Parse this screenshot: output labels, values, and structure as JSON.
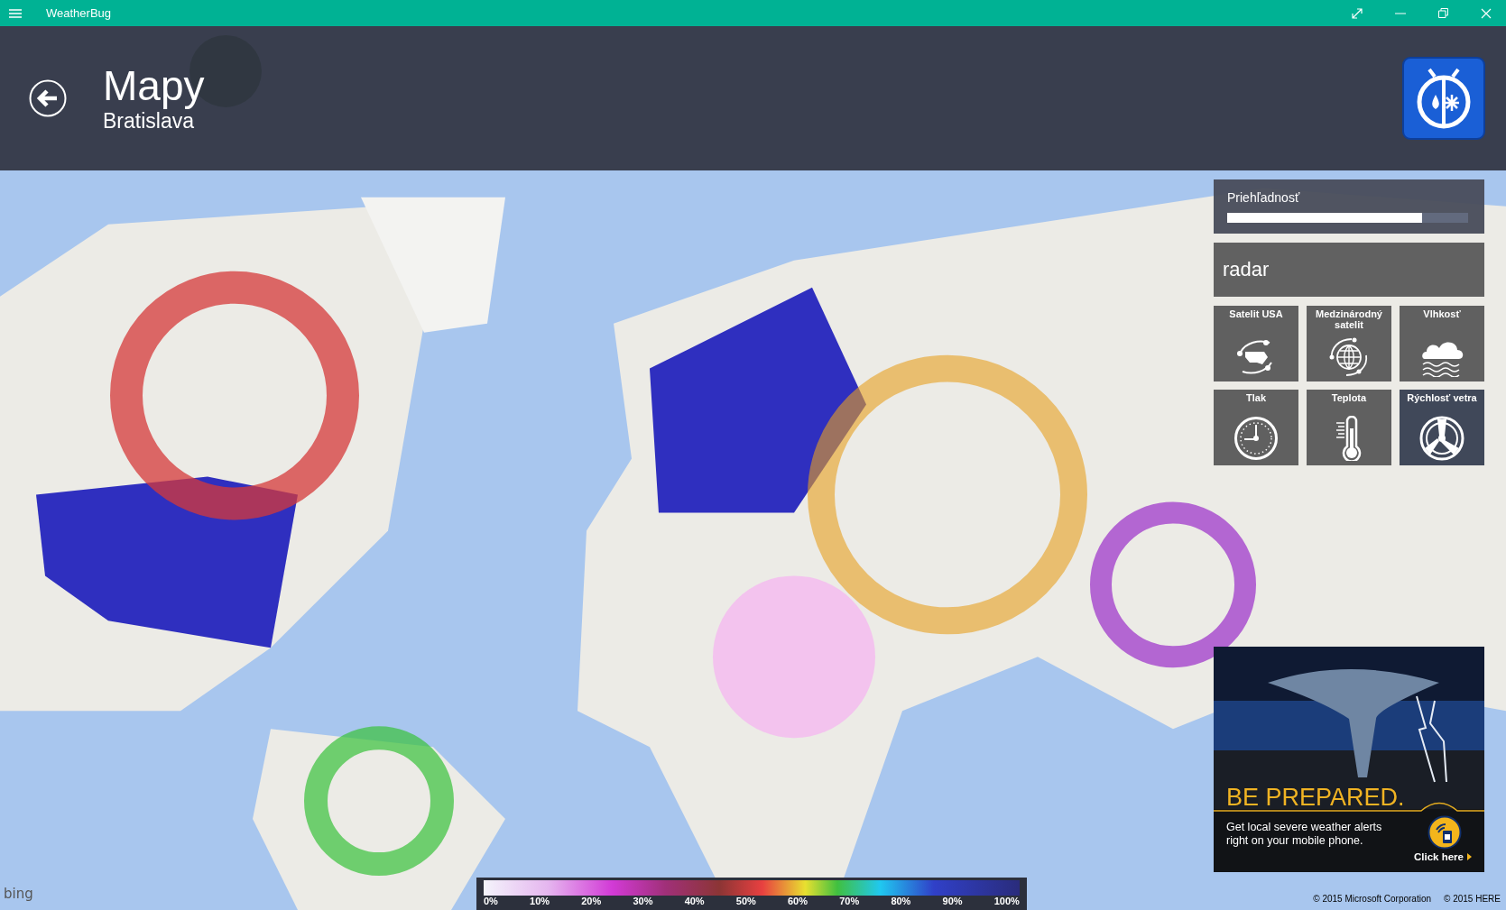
{
  "window": {
    "title": "WeatherBug"
  },
  "header": {
    "title": "Mapy",
    "subtitle": "Bratislava"
  },
  "transparency": {
    "label": "Priehľadnosť",
    "level": 0.81
  },
  "layer_group": {
    "label": "radar"
  },
  "layers": [
    {
      "label": "Satelit USA",
      "kind": "usa_satellite",
      "selected": false
    },
    {
      "label": "Medzinárodný satelit",
      "kind": "world_satellite",
      "selected": false
    },
    {
      "label": "Vlhkosť",
      "kind": "humidity",
      "selected": false
    },
    {
      "label": "Tlak",
      "kind": "pressure",
      "selected": false
    },
    {
      "label": "Teplota",
      "kind": "temperature",
      "selected": false
    },
    {
      "label": "Rýchlosť vetra",
      "kind": "wind",
      "selected": true
    }
  ],
  "ad": {
    "headline": "BE PREPARED.",
    "text": "Get local severe weather alerts right on your mobile phone.",
    "link": "Click here"
  },
  "legend": [
    "0%",
    "10%",
    "20%",
    "30%",
    "40%",
    "50%",
    "60%",
    "70%",
    "80%",
    "90%",
    "100%"
  ],
  "map_logo": "bing",
  "copyright": [
    "© 2015 Microsoft Corporation",
    "© 2015 HERE"
  ]
}
